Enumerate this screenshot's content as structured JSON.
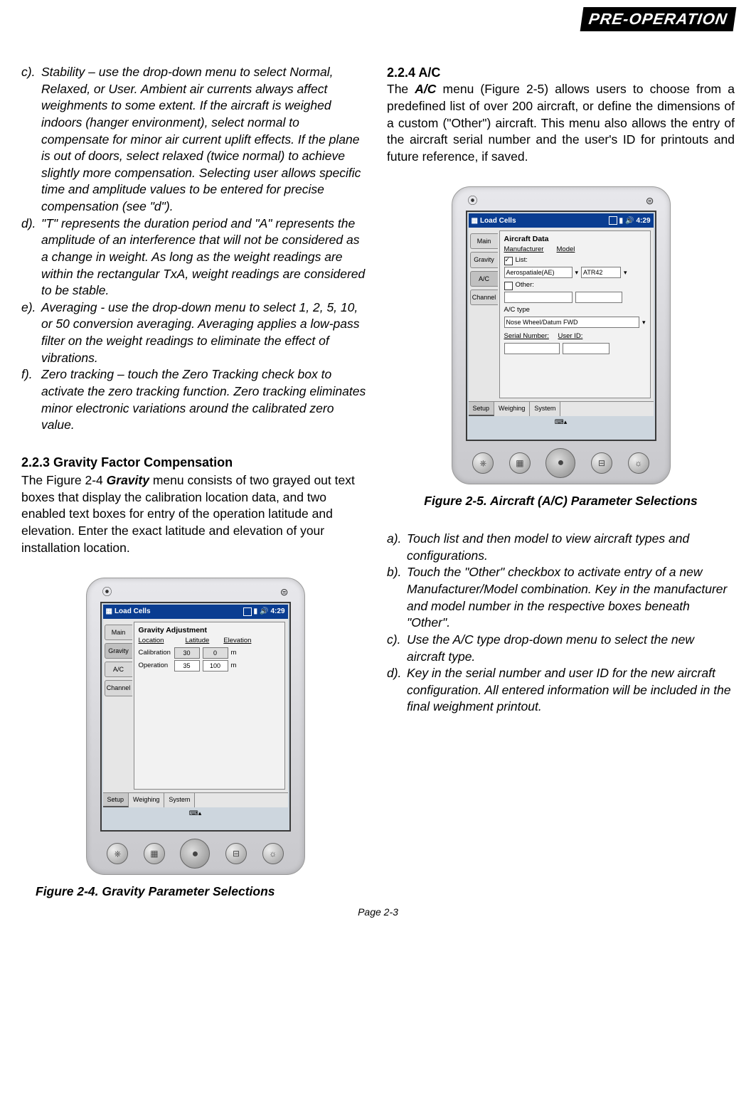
{
  "header": {
    "tab": "PRE-OPERATION"
  },
  "left": {
    "itemC": {
      "label": "c).",
      "text": "Stability – use the drop-down menu to select Normal, Relaxed, or User. Ambient air currents always affect weighments to some extent. If the aircraft is weighed indoors (hanger environment), select normal to compensate for minor air current uplift effects. If the plane is out of doors, select relaxed (twice normal) to achieve slightly more compensation. Selecting user allows specific time and amplitude values to be entered for precise compensation (see \"d\")."
    },
    "itemD": {
      "label": "d).",
      "text": "\"T\" represents the duration period and \"A\" represents the amplitude of an interference that will not be considered as a change in weight. As long as the weight readings are within the rectangular TxA, weight readings are considered to be stable."
    },
    "itemE": {
      "label": "e).",
      "text": "Averaging - use the drop-down menu to select 1, 2, 5, 10, or 50 conversion averaging. Averaging applies a low-pass filter on the weight readings to eliminate the effect of vibrations."
    },
    "itemF": {
      "label": "f).",
      "text": "Zero tracking – touch the Zero Tracking check box to activate the zero tracking function. Zero tracking eliminates minor electronic variations around the calibrated zero value."
    },
    "s223title": "2.2.3 Gravity Factor Compensation",
    "s223body1": "The Figure 2-4 ",
    "s223gravity": "Gravity",
    "s223body2": " menu consists of two  grayed out text boxes that display the calibration location data, and two enabled text boxes for entry of the operation latitude and elevation. Enter the exact latitude and elevation of your installation location.",
    "fig24caption": "Figure 2-4. Gravity Parameter Selections"
  },
  "right": {
    "s224title": "2.2.4 A/C",
    "s224lead": "The ",
    "s224ac": "A/C",
    "s224body": " menu (Figure 2-5) allows users to choose from a predefined list of over 200 aircraft, or define the dimensions of a custom (\"Other\") aircraft. This menu also allows the entry of the aircraft serial number and the user's ID for printouts and future reference, if saved.",
    "fig25caption": "Figure 2-5. Aircraft (A/C)  Parameter Selections",
    "itemA": {
      "label": "a).",
      "text": "Touch list and then model to view aircraft types and configurations."
    },
    "itemB": {
      "label": "b).",
      "text": "Touch the \"Other\" checkbox to activate entry of a new Manufacturer/Model combination. Key in the manufacturer and model number in the respective boxes beneath \"Other\"."
    },
    "itemC": {
      "label": "c).",
      "text": "Use the A/C type drop-down menu to select the new aircraft type."
    },
    "itemD": {
      "label": "d).",
      "text": "Key in the serial number and user ID for the new aircraft configuration. All entered information will be included in the final weighment printout."
    }
  },
  "pda_common": {
    "apptitle": "Load Cells",
    "time": "4:29",
    "sidetabs": [
      "Main",
      "Gravity",
      "A/C",
      "Channel"
    ],
    "btabs": [
      "Setup",
      "Weighing",
      "System"
    ],
    "topicons": {
      "main": "⦿",
      "rec": "⊜"
    }
  },
  "fig24": {
    "panel_title": "Gravity Adjustment",
    "hdrs": [
      "Location",
      "Latitude",
      "Elevation"
    ],
    "rows": [
      {
        "l": "Calibration",
        "a": "30",
        "b": "0",
        "u": "m"
      },
      {
        "l": "Operation",
        "a": "35",
        "b": "100",
        "u": "m"
      }
    ]
  },
  "fig25": {
    "panel_title": "Aircraft Data",
    "sub1": "Manufacturer",
    "sub2": "Model",
    "list_l": "List:",
    "list_v": "Aerospatiale(AE)",
    "list_v2": "ATR42",
    "other_l": "Other:",
    "actype_l": "A/C type",
    "actype_v": "Nose Wheel/Datum FWD",
    "sn_l": "Serial Number:",
    "uid_l": "User ID:"
  },
  "footer": {
    "page": "Page 2-3"
  }
}
